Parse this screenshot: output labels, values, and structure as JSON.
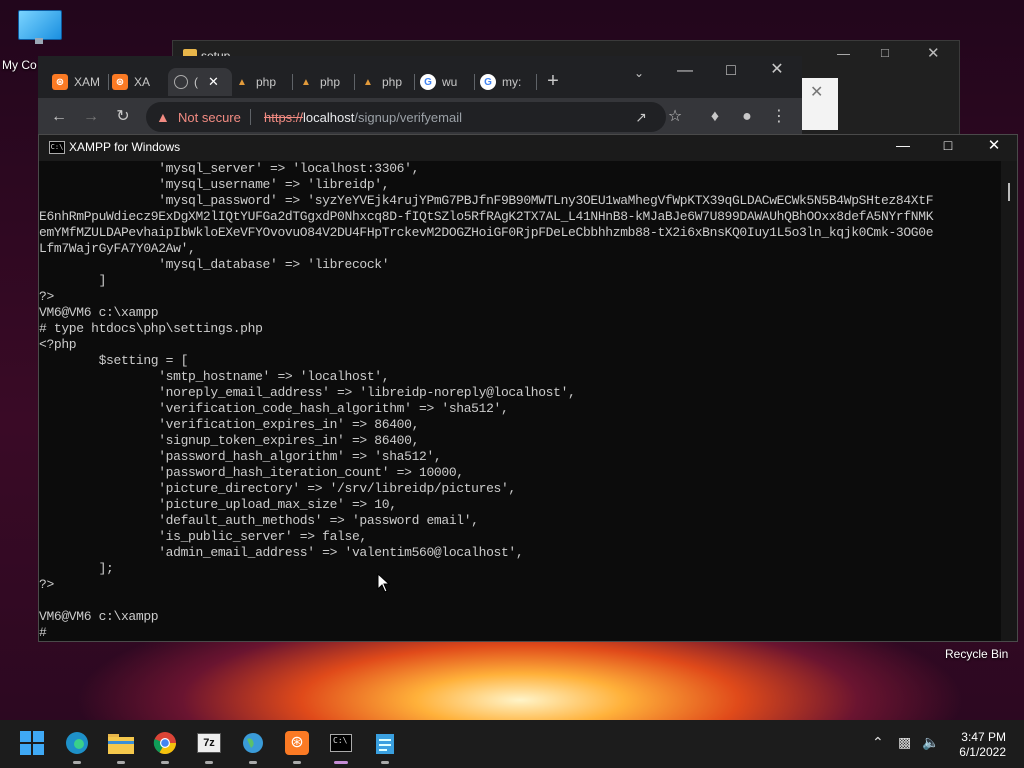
{
  "desktop": {
    "icons": [
      {
        "label": "My Co"
      },
      {
        "label": "Recycle Bin"
      }
    ]
  },
  "explorer": {
    "title": "setup"
  },
  "browser": {
    "tabs": [
      {
        "label": "XAM",
        "icon": "xampp-icon"
      },
      {
        "label": "XA",
        "icon": "xampp-icon"
      },
      {
        "label": "(",
        "icon": "globe-icon",
        "active": true
      },
      {
        "label": "php",
        "icon": "php-icon"
      },
      {
        "label": "php",
        "icon": "php-icon"
      },
      {
        "label": "php",
        "icon": "php-icon"
      },
      {
        "label": "wu",
        "icon": "google-icon"
      },
      {
        "label": "my:",
        "icon": "google-icon"
      }
    ],
    "security_label": "Not secure",
    "url_protocol": "https://",
    "url_host": "localhost",
    "url_path": "/signup/verifyemail"
  },
  "console": {
    "title": "XAMPP for Windows",
    "lines": [
      "                'mysql_server' => 'localhost:3306',",
      "                'mysql_username' => 'libreidp',",
      "                'mysql_password' => 'syzYeYVEjk4rujYPmG7PBJfnF9B90MWTLny3OEU1waMhegVfWpKTX39qGLDACwECWk5N5B4WpSHtez84XtF",
      "E6nhRmPpuWdiecz9ExDgXM2lIQtYUFGa2dTGgxdP0Nhxcq8D-fIQtSZlo5RfRAgK2TX7AL_L41NHnB8-kMJaBJe6W7U899DAWAUhQBhOOxx8defA5NYrfNMK",
      "emYMfMZULDAPevhaipIbWkloEXeVFYOvovuO84V2DU4FHpTrckevM2DOGZHoiGF0RjpFDeLeCbbhhzmb88-tX2i6xBnsKQ0Iuy1L5o3ln_kqjk0Cmk-3OG0e",
      "Lfm7WajrGyFA7Y0A2Aw',",
      "                'mysql_database' => 'librecock'",
      "        ]",
      "?>",
      "VM6@VM6 c:\\xampp",
      "# type htdocs\\php\\settings.php",
      "<?php",
      "        $setting = [",
      "                'smtp_hostname' => 'localhost',",
      "                'noreply_email_address' => 'libreidp-noreply@localhost',",
      "                'verification_code_hash_algorithm' => 'sha512',",
      "                'verification_expires_in' => 86400,",
      "                'signup_token_expires_in' => 86400,",
      "                'password_hash_algorithm' => 'sha512',",
      "                'password_hash_iteration_count' => 10000,",
      "                'picture_directory' => '/srv/libreidp/pictures',",
      "                'picture_upload_max_size' => 10,",
      "                'default_auth_methods' => 'password email',",
      "                'is_public_server' => false,",
      "                'admin_email_address' => 'valentim560@localhost',",
      "        ];",
      "?>",
      "",
      "VM6@VM6 c:\\xampp",
      "#"
    ]
  },
  "taskbar": {
    "apps": [
      {
        "name": "start-button"
      },
      {
        "name": "edge-app"
      },
      {
        "name": "file-explorer-app"
      },
      {
        "name": "chrome-app"
      },
      {
        "name": "7zip-app"
      },
      {
        "name": "network-app"
      },
      {
        "name": "xampp-app"
      },
      {
        "name": "terminal-app",
        "running": true
      },
      {
        "name": "notepad-app"
      }
    ],
    "time": "3:47 PM",
    "date": "6/1/2022"
  }
}
